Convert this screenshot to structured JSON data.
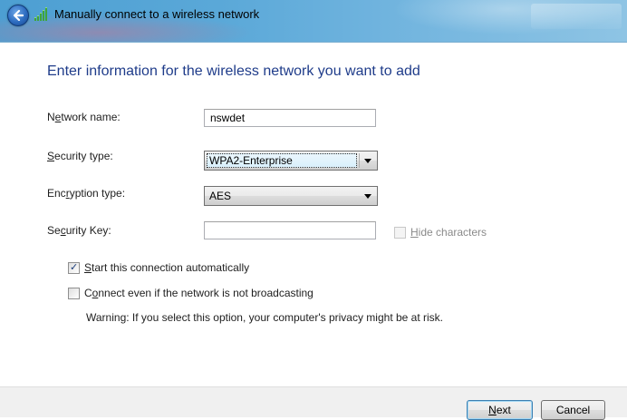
{
  "window": {
    "title": "Manually connect to a wireless network",
    "back_icon": "back-arrow-icon",
    "wireless_icon": "wireless-signal-icon"
  },
  "form": {
    "heading": "Enter information for the wireless network you want to add",
    "network_name": {
      "label_pre": "N",
      "label_ul": "e",
      "label_post": "twork name:",
      "value": "nswdet"
    },
    "security_type": {
      "label_pre": "",
      "label_ul": "S",
      "label_post": "ecurity type:",
      "value": "WPA2-Enterprise"
    },
    "encryption_type": {
      "label_pre": "Enc",
      "label_ul": "r",
      "label_post": "yption type:",
      "value": "AES"
    },
    "security_key": {
      "label_pre": "Se",
      "label_ul": "c",
      "label_post": "urity Key:",
      "value": ""
    },
    "hide_characters": {
      "label_pre": "",
      "label_ul": "H",
      "label_post": "ide characters",
      "checked": false,
      "enabled": false
    },
    "start_auto": {
      "label_pre": "",
      "label_ul": "S",
      "label_post": "tart this connection automatically",
      "checked": true
    },
    "connect_broadcast": {
      "label_pre": "C",
      "label_ul": "o",
      "label_post": "nnect even if the network is not broadcasting",
      "checked": false
    },
    "warning": "Warning: If you select this option, your computer's privacy might be at risk."
  },
  "buttons": {
    "next_pre": "",
    "next_ul": "N",
    "next_post": "ext",
    "cancel": "Cancel"
  },
  "colors": {
    "heading": "#1f3c8a",
    "titlebar": "#5aa8d8"
  }
}
